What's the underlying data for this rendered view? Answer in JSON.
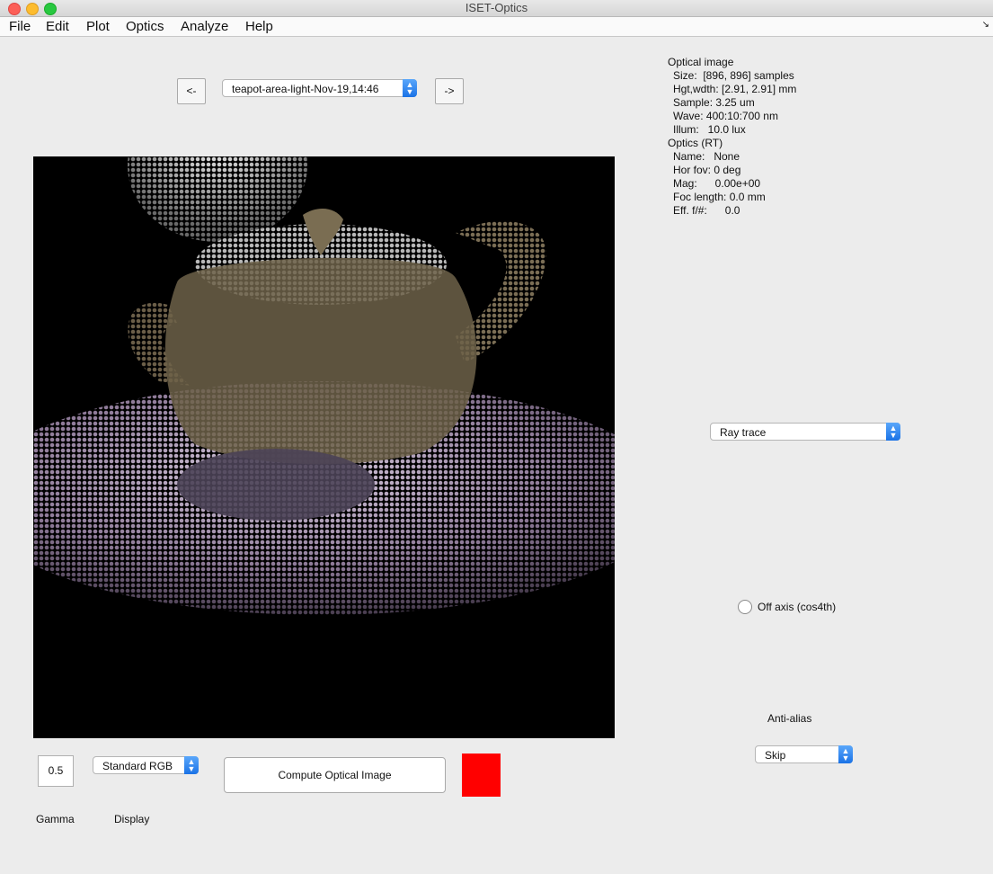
{
  "window": {
    "title": "ISET-Optics"
  },
  "menu": [
    "File",
    "Edit",
    "Plot",
    "Optics",
    "Analyze",
    "Help"
  ],
  "nav": {
    "prev": "<-",
    "next": "->",
    "selected": "teapot-area-light-Nov-19,14:46"
  },
  "info": {
    "oi_header": "Optical image",
    "oi_lines": [
      "Size:  [896, 896] samples",
      "Hgt,wdth: [2.91, 2.91] mm",
      "Sample: 3.25 um",
      "Wave: 400:10:700 nm",
      "Illum:   10.0 lux"
    ],
    "optics_header": "Optics (RT)",
    "optics_lines": [
      "Name:   None",
      "Hor fov: 0 deg",
      "Mag:      0.00e+00",
      "Foc length: 0.0 mm",
      "Eff. f/#:      0.0"
    ]
  },
  "method": {
    "selected": "Ray trace"
  },
  "off_axis": {
    "label": "Off axis (cos4th)",
    "checked": false
  },
  "anti_alias": {
    "label": "Anti-alias",
    "selected": "Skip"
  },
  "gamma": {
    "value": "0.5",
    "label": "Gamma"
  },
  "display": {
    "selected": "Standard RGB",
    "label": "Display"
  },
  "compute": {
    "label": "Compute Optical Image"
  },
  "status_color": "#ff0000",
  "icons": {
    "close": "close-icon",
    "minimize": "minimize-icon",
    "zoom": "zoom-icon",
    "popup": "chevron-updown-icon"
  }
}
